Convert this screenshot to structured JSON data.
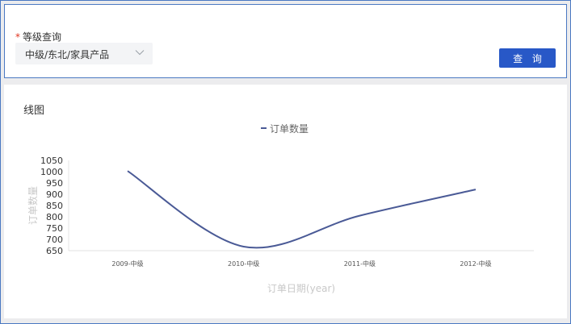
{
  "filter": {
    "label": "等级查询",
    "required_mark": "*",
    "select_value": "中级/东北/家具产品",
    "query_button": "查 询"
  },
  "chart": {
    "title": "线图"
  },
  "colors": {
    "accent": "#2858c7",
    "line": "#4a5a96",
    "required": "#e0341f"
  },
  "chart_data": {
    "type": "line",
    "categories": [
      "2009-中级",
      "2010-中级",
      "2011-中级",
      "2012-中级"
    ],
    "series": [
      {
        "name": "订单数量",
        "values": [
          1003,
          668,
          805,
          921
        ]
      }
    ],
    "xlabel": "订单日期(year)",
    "ylabel": "订单数量",
    "yticks": [
      650,
      700,
      750,
      800,
      850,
      900,
      950,
      1000,
      1050
    ],
    "ylim": [
      650,
      1050
    ],
    "legend": "top-center",
    "grid": false
  }
}
